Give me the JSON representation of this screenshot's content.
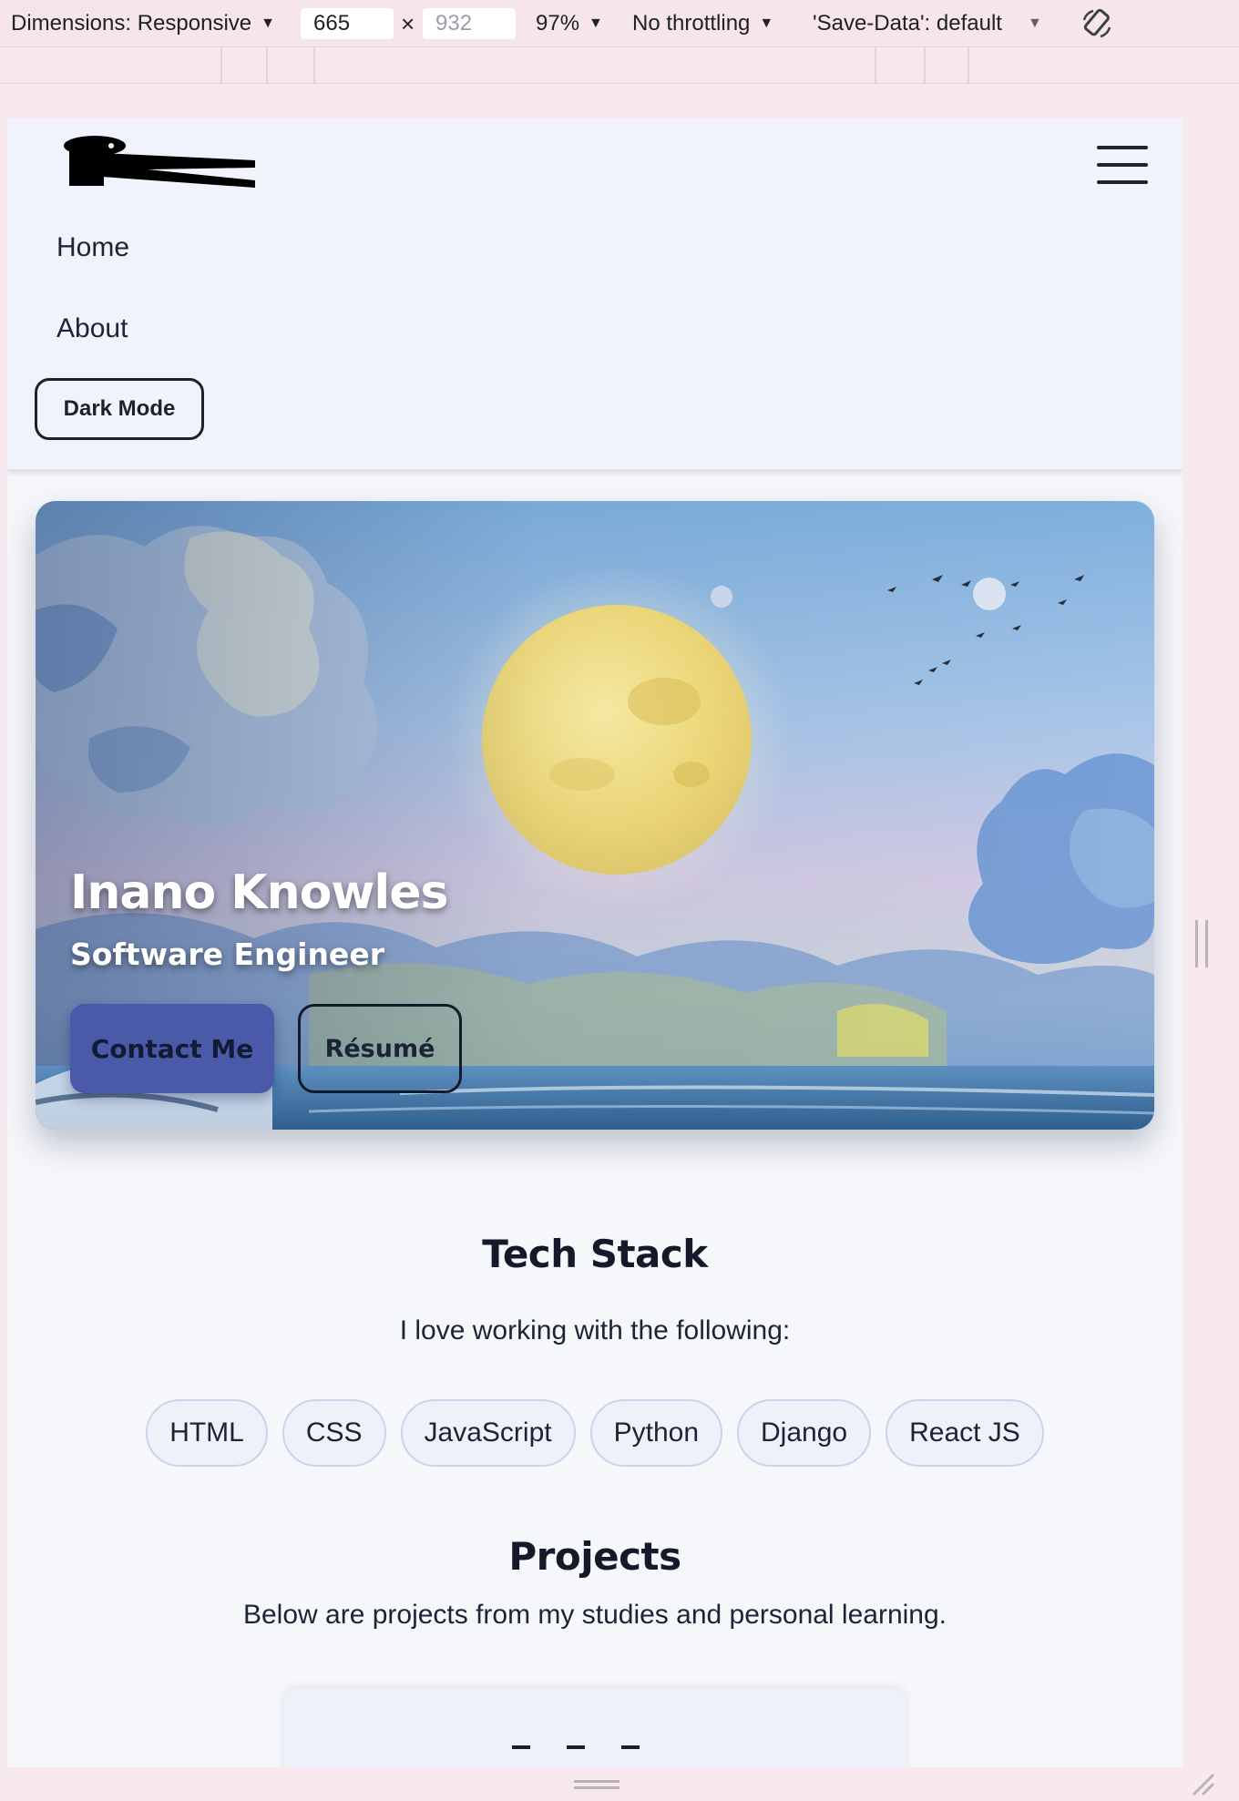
{
  "devtools": {
    "dimensions_label": "Dimensions: Responsive",
    "width_value": "665",
    "times_symbol": "×",
    "height_value": "932",
    "zoom_label": "97%",
    "throttling_label": "No throttling",
    "save_data_label": "'Save-Data': default"
  },
  "nav": {
    "links": [
      {
        "label": "Home"
      },
      {
        "label": "About"
      }
    ],
    "dark_mode_label": "Dark Mode"
  },
  "hero": {
    "name": "Inano Knowles",
    "title": "Software Engineer",
    "contact_label": "Contact Me",
    "resume_label": "Résumé"
  },
  "tech_stack": {
    "heading": "Tech Stack",
    "intro": "I love working with the following:",
    "items": [
      "HTML",
      "CSS",
      "JavaScript",
      "Python",
      "Django",
      "React JS"
    ]
  },
  "projects": {
    "heading": "Projects",
    "intro": "Below are projects from my studies and personal learning."
  },
  "colors": {
    "accent_button": "#4a59a8",
    "nav_background": "#f0f3fb",
    "page_background": "#f6f7fb",
    "devtools_background": "#f6e6ec"
  },
  "icons": {
    "menu": "hamburger-menu-icon",
    "rotate": "rotate-device-icon",
    "logo": "logo-icon"
  }
}
